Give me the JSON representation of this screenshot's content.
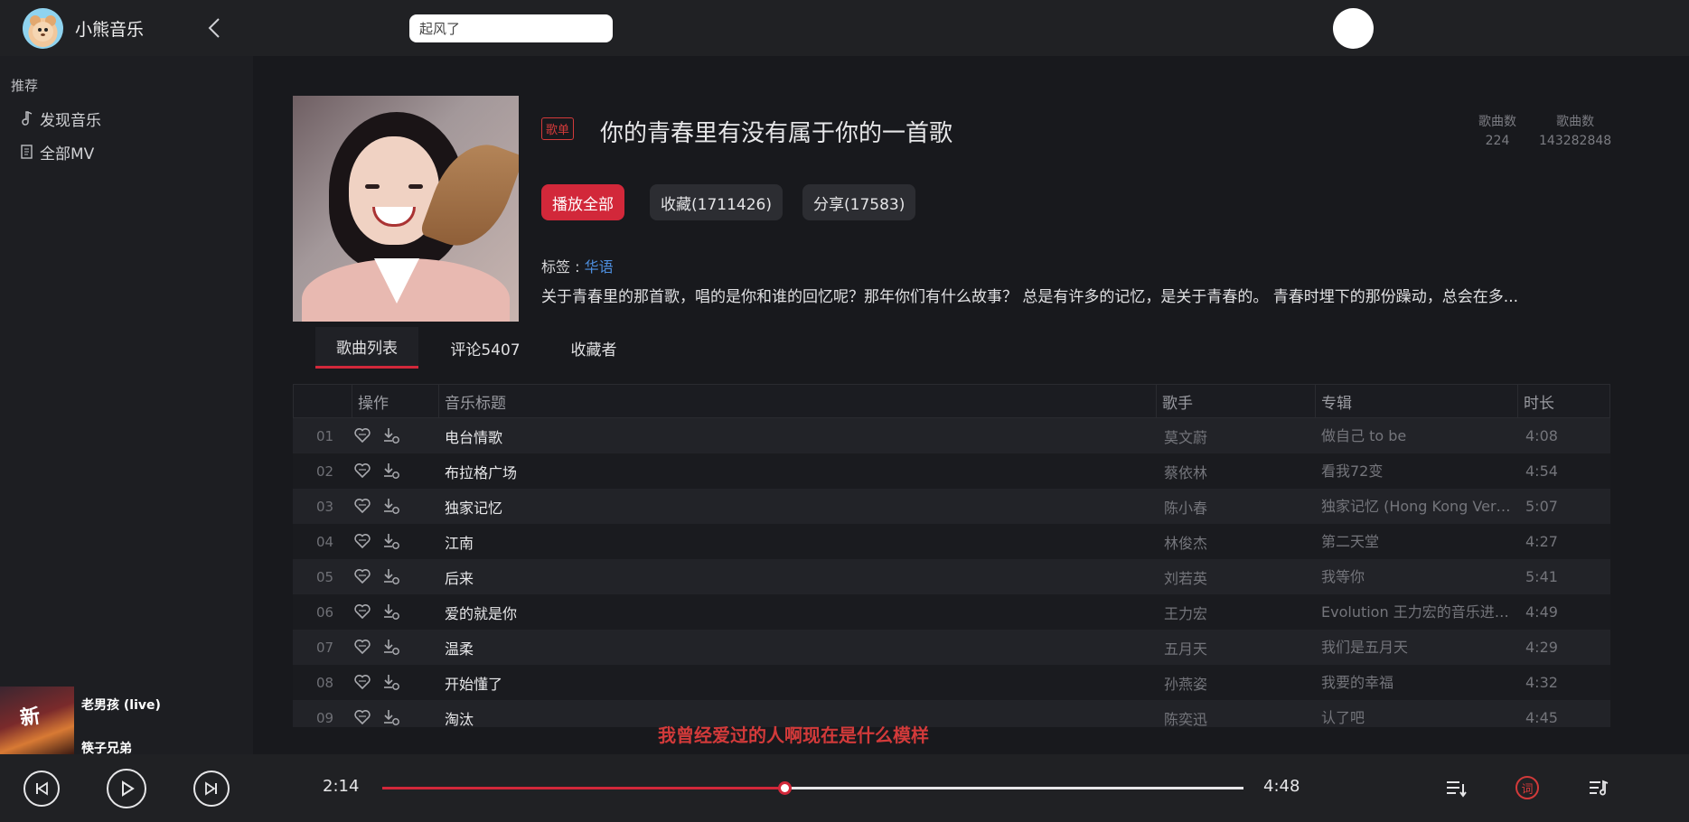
{
  "app": {
    "name": "小熊音乐"
  },
  "search": {
    "value": "起风了"
  },
  "sidebar": {
    "section": "推荐",
    "items": [
      {
        "label": "发现音乐",
        "icon": "music-note-icon"
      },
      {
        "label": "全部MV",
        "icon": "document-icon"
      }
    ],
    "recent": {
      "title": "老男孩 (live)",
      "artist": "筷子兄弟",
      "cover_text": "新"
    }
  },
  "playlist": {
    "badge": "歌单",
    "title": "你的青春里有没有属于你的一首歌",
    "stats": [
      {
        "label": "歌曲数",
        "value": "224"
      },
      {
        "label": "歌曲数",
        "value": "143282848"
      }
    ],
    "play_all": "播放全部",
    "collect": "收藏(1711426)",
    "share": "分享(17583)",
    "tags_label": "标签 :",
    "tag": "华语",
    "description": "关于青春里的那首歌，唱的是你和谁的回忆呢？那年你们有什么故事？ 总是有许多的记忆，是关于青春的。 青春时埋下的那份躁动，总会在多..."
  },
  "tabs": [
    "歌曲列表",
    "评论5407",
    "收藏者"
  ],
  "table": {
    "headers": [
      "操作",
      "音乐标题",
      "歌手",
      "专辑",
      "时长"
    ],
    "rows": [
      {
        "num": "01",
        "title": "电台情歌",
        "artist": "莫文蔚",
        "album": "做自己 to be",
        "duration": "4:08"
      },
      {
        "num": "02",
        "title": "布拉格广场",
        "artist": "蔡依林",
        "album": "看我72变",
        "duration": "4:54"
      },
      {
        "num": "03",
        "title": "独家记忆",
        "artist": "陈小春",
        "album": "独家记忆 (Hong Kong Version)",
        "duration": "5:07"
      },
      {
        "num": "04",
        "title": "江南",
        "artist": "林俊杰",
        "album": "第二天堂",
        "duration": "4:27"
      },
      {
        "num": "05",
        "title": "后来",
        "artist": "刘若英",
        "album": "我等你",
        "duration": "5:41"
      },
      {
        "num": "06",
        "title": "爱的就是你",
        "artist": "王力宏",
        "album": "Evolution 王力宏的音乐进化论",
        "duration": "4:49"
      },
      {
        "num": "07",
        "title": "温柔",
        "artist": "五月天",
        "album": "我们是五月天",
        "duration": "4:29"
      },
      {
        "num": "08",
        "title": "开始懂了",
        "artist": "孙燕姿",
        "album": "我要的幸福",
        "duration": "4:32"
      },
      {
        "num": "09",
        "title": "淘汰",
        "artist": "陈奕迅",
        "album": "认了吧",
        "duration": "4:45"
      }
    ]
  },
  "lyric": "我曾经爱过的人啊现在是什么模样",
  "player": {
    "current_time": "2:14",
    "total_time": "4:48",
    "progress": 0.4667,
    "lyric_button": "词",
    "accent": "#d2283a"
  }
}
